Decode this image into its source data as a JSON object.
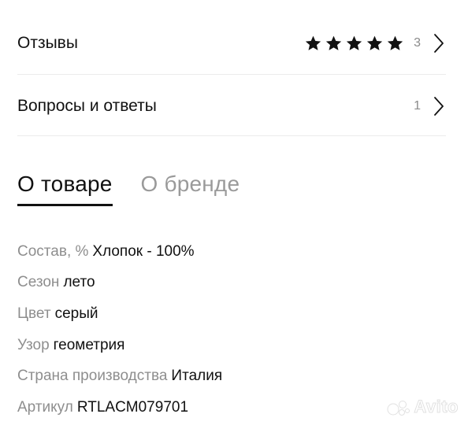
{
  "reviews": {
    "label": "Отзывы",
    "rating_stars": 5,
    "rating_max": 5,
    "count": "3",
    "chevron_icon": "chevron-right-icon",
    "star_icon": "star-icon"
  },
  "qa": {
    "label": "Вопросы и ответы",
    "count": "1",
    "chevron_icon": "chevron-right-icon"
  },
  "tabs": [
    {
      "label": "О товаре",
      "active": true
    },
    {
      "label": "О бренде",
      "active": false
    }
  ],
  "specs": [
    {
      "label": "Состав, %",
      "value": "Хлопок - 100%"
    },
    {
      "label": "Сезон",
      "value": "лето"
    },
    {
      "label": "Цвет",
      "value": "серый"
    },
    {
      "label": "Узор",
      "value": "геометрия"
    },
    {
      "label": "Страна производства",
      "value": "Италия"
    },
    {
      "label": "Артикул",
      "value": "RTLACM079701"
    }
  ],
  "watermark": {
    "text": "Avito"
  },
  "colors": {
    "text_primary": "#111111",
    "text_secondary": "#8e8e8e",
    "tab_inactive": "#9a9a9a",
    "divider": "#ececec"
  }
}
